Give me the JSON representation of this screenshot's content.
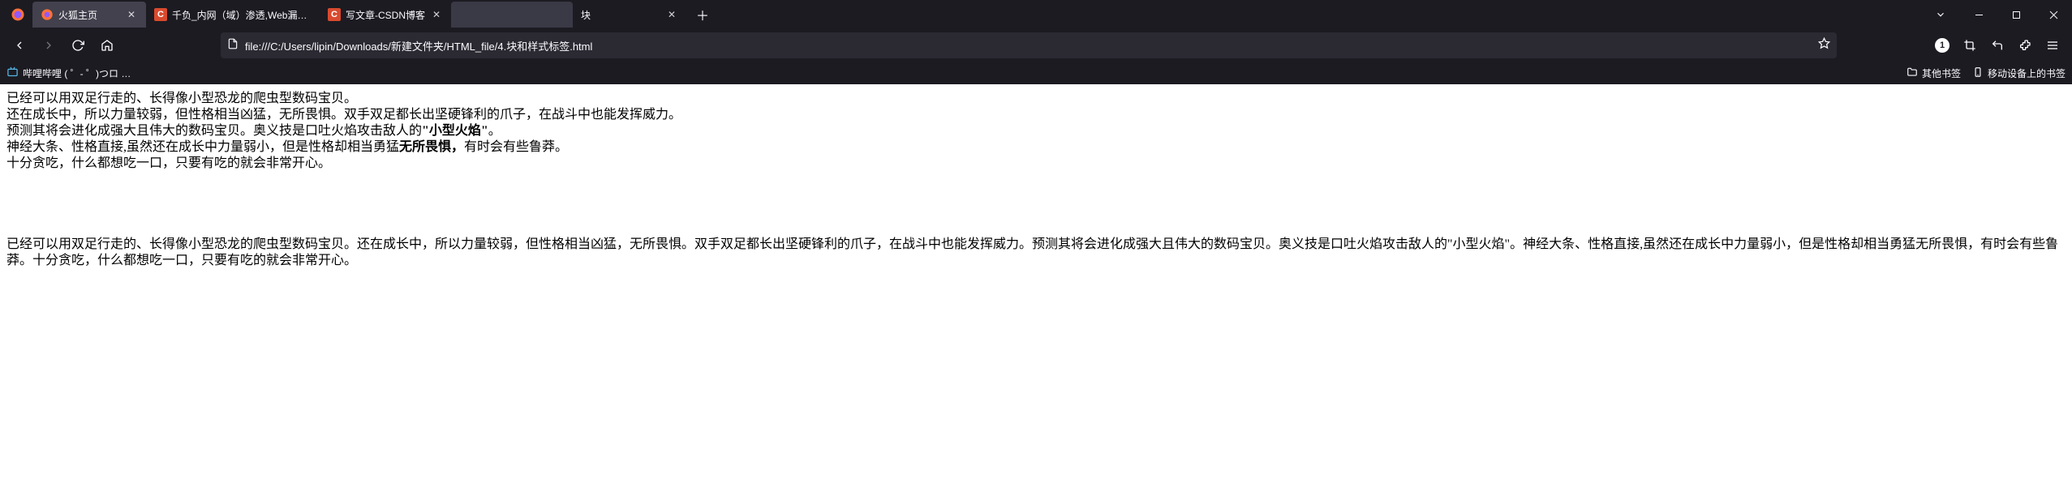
{
  "tabs": [
    {
      "title": "火狐主页",
      "icon": "firefox",
      "active": true
    },
    {
      "title": "千负_内网（域）渗透,Web漏洞…",
      "icon": "c-badge"
    },
    {
      "title": "写文章-CSDN博客",
      "icon": "c-badge"
    },
    {
      "title": "",
      "icon": "none",
      "obscured": true
    },
    {
      "title": "块",
      "icon": "none",
      "closable": true
    }
  ],
  "url": "file:///C:/Users/lipin/Downloads/新建文件夹/HTML_file/4.块和样式标签.html",
  "bookmarks": {
    "left": [
      {
        "label": "哔哩哔哩 ( ゜- ゜)つロ …",
        "icon": "bili"
      }
    ],
    "right": [
      {
        "label": "其他书签",
        "icon": "folder"
      },
      {
        "label": "移动设备上的书签",
        "icon": "mobile"
      }
    ]
  },
  "toolbar_badge": "1",
  "content": {
    "lines": [
      {
        "pre": "已经可以用双足行走的、长得像小型恐龙的爬虫型数码宝贝。",
        "bold": "",
        "post": ""
      },
      {
        "pre": "还在成长中，所以力量较弱，但性格相当凶猛，无所畏惧。双手双足都长出坚硬锋利的爪子，在战斗中也能发挥威力。",
        "bold": "",
        "post": ""
      },
      {
        "pre": "预测其将会进化成强大且伟大的数码宝贝。奥义技是口吐火焰攻击敌人的",
        "bold": "\"小型火焰\"",
        "post": "。"
      },
      {
        "pre": "神经大条、性格直接,虽然还在成长中力量弱小，但是性格却相当勇猛",
        "bold": "无所畏惧，",
        "post": "有时会有些鲁莽。"
      },
      {
        "pre": "十分贪吃，什么都想吃一口，只要有吃的就会非常开心。",
        "bold": "",
        "post": ""
      }
    ],
    "paragraph": "已经可以用双足行走的、长得像小型恐龙的爬虫型数码宝贝。还在成长中，所以力量较弱，但性格相当凶猛，无所畏惧。双手双足都长出坚硬锋利的爪子，在战斗中也能发挥威力。预测其将会进化成强大且伟大的数码宝贝。奥义技是口吐火焰攻击敌人的\"小型火焰\"。神经大条、性格直接,虽然还在成长中力量弱小，但是性格却相当勇猛无所畏惧，有时会有些鲁莽。十分贪吃，什么都想吃一口，只要有吃的就会非常开心。"
  }
}
